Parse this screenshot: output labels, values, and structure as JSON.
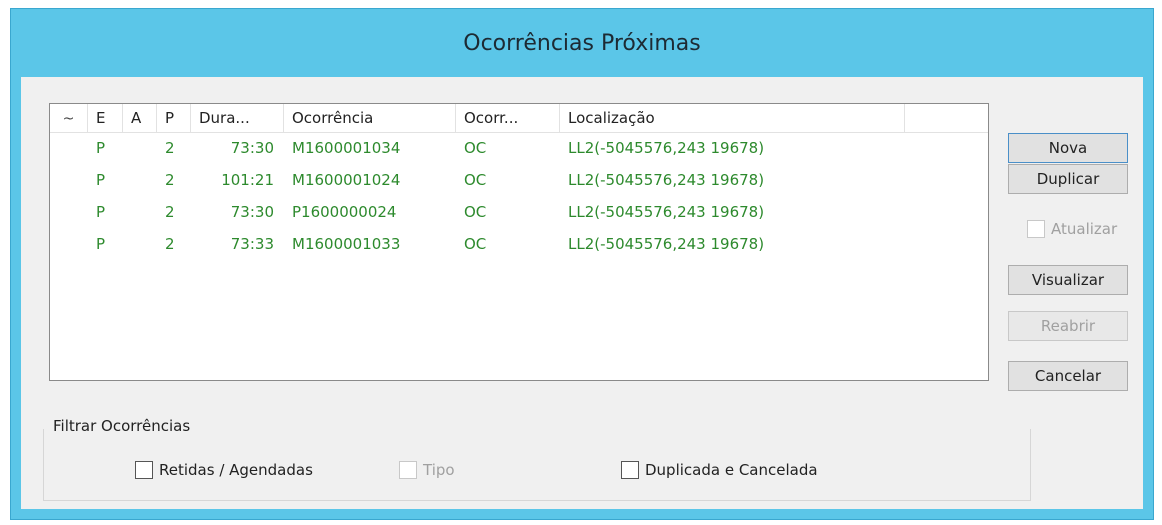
{
  "window": {
    "title": "Ocorrências Próximas"
  },
  "list": {
    "columns": [
      "~",
      "E",
      "A",
      "P",
      "Dura...",
      "Ocorrência",
      "Ocorr...",
      "Localização"
    ],
    "rows": [
      {
        "til": "",
        "e": "P",
        "a": "",
        "p": "2",
        "duration": "73:30",
        "ocorrencia": "M1600001034",
        "ocorr": "OC",
        "localizacao": "LL2(-5045576,243 19678)"
      },
      {
        "til": "",
        "e": "P",
        "a": "",
        "p": "2",
        "duration": "101:21",
        "ocorrencia": "M1600001024",
        "ocorr": "OC",
        "localizacao": "LL2(-5045576,243 19678)"
      },
      {
        "til": "",
        "e": "P",
        "a": "",
        "p": "2",
        "duration": "73:30",
        "ocorrencia": "P1600000024",
        "ocorr": "OC",
        "localizacao": "LL2(-5045576,243 19678)"
      },
      {
        "til": "",
        "e": "P",
        "a": "",
        "p": "2",
        "duration": "73:33",
        "ocorrencia": "M1600001033",
        "ocorr": "OC",
        "localizacao": "LL2(-5045576,243 19678)"
      }
    ]
  },
  "buttons": {
    "nova": "Nova",
    "duplicar": "Duplicar",
    "atualizar": "Atualizar",
    "visualizar": "Visualizar",
    "reabrir": "Reabrir",
    "cancelar": "Cancelar"
  },
  "filter": {
    "legend": "Filtrar Ocorrências",
    "retidas": "Retidas / Agendadas",
    "tipo": "Tipo",
    "duplicada": "Duplicada e Cancelada"
  },
  "colors": {
    "title_bar": "#5bc6e8",
    "row_text": "#2d8a2d",
    "dialog_bg": "#f0f0f0"
  }
}
